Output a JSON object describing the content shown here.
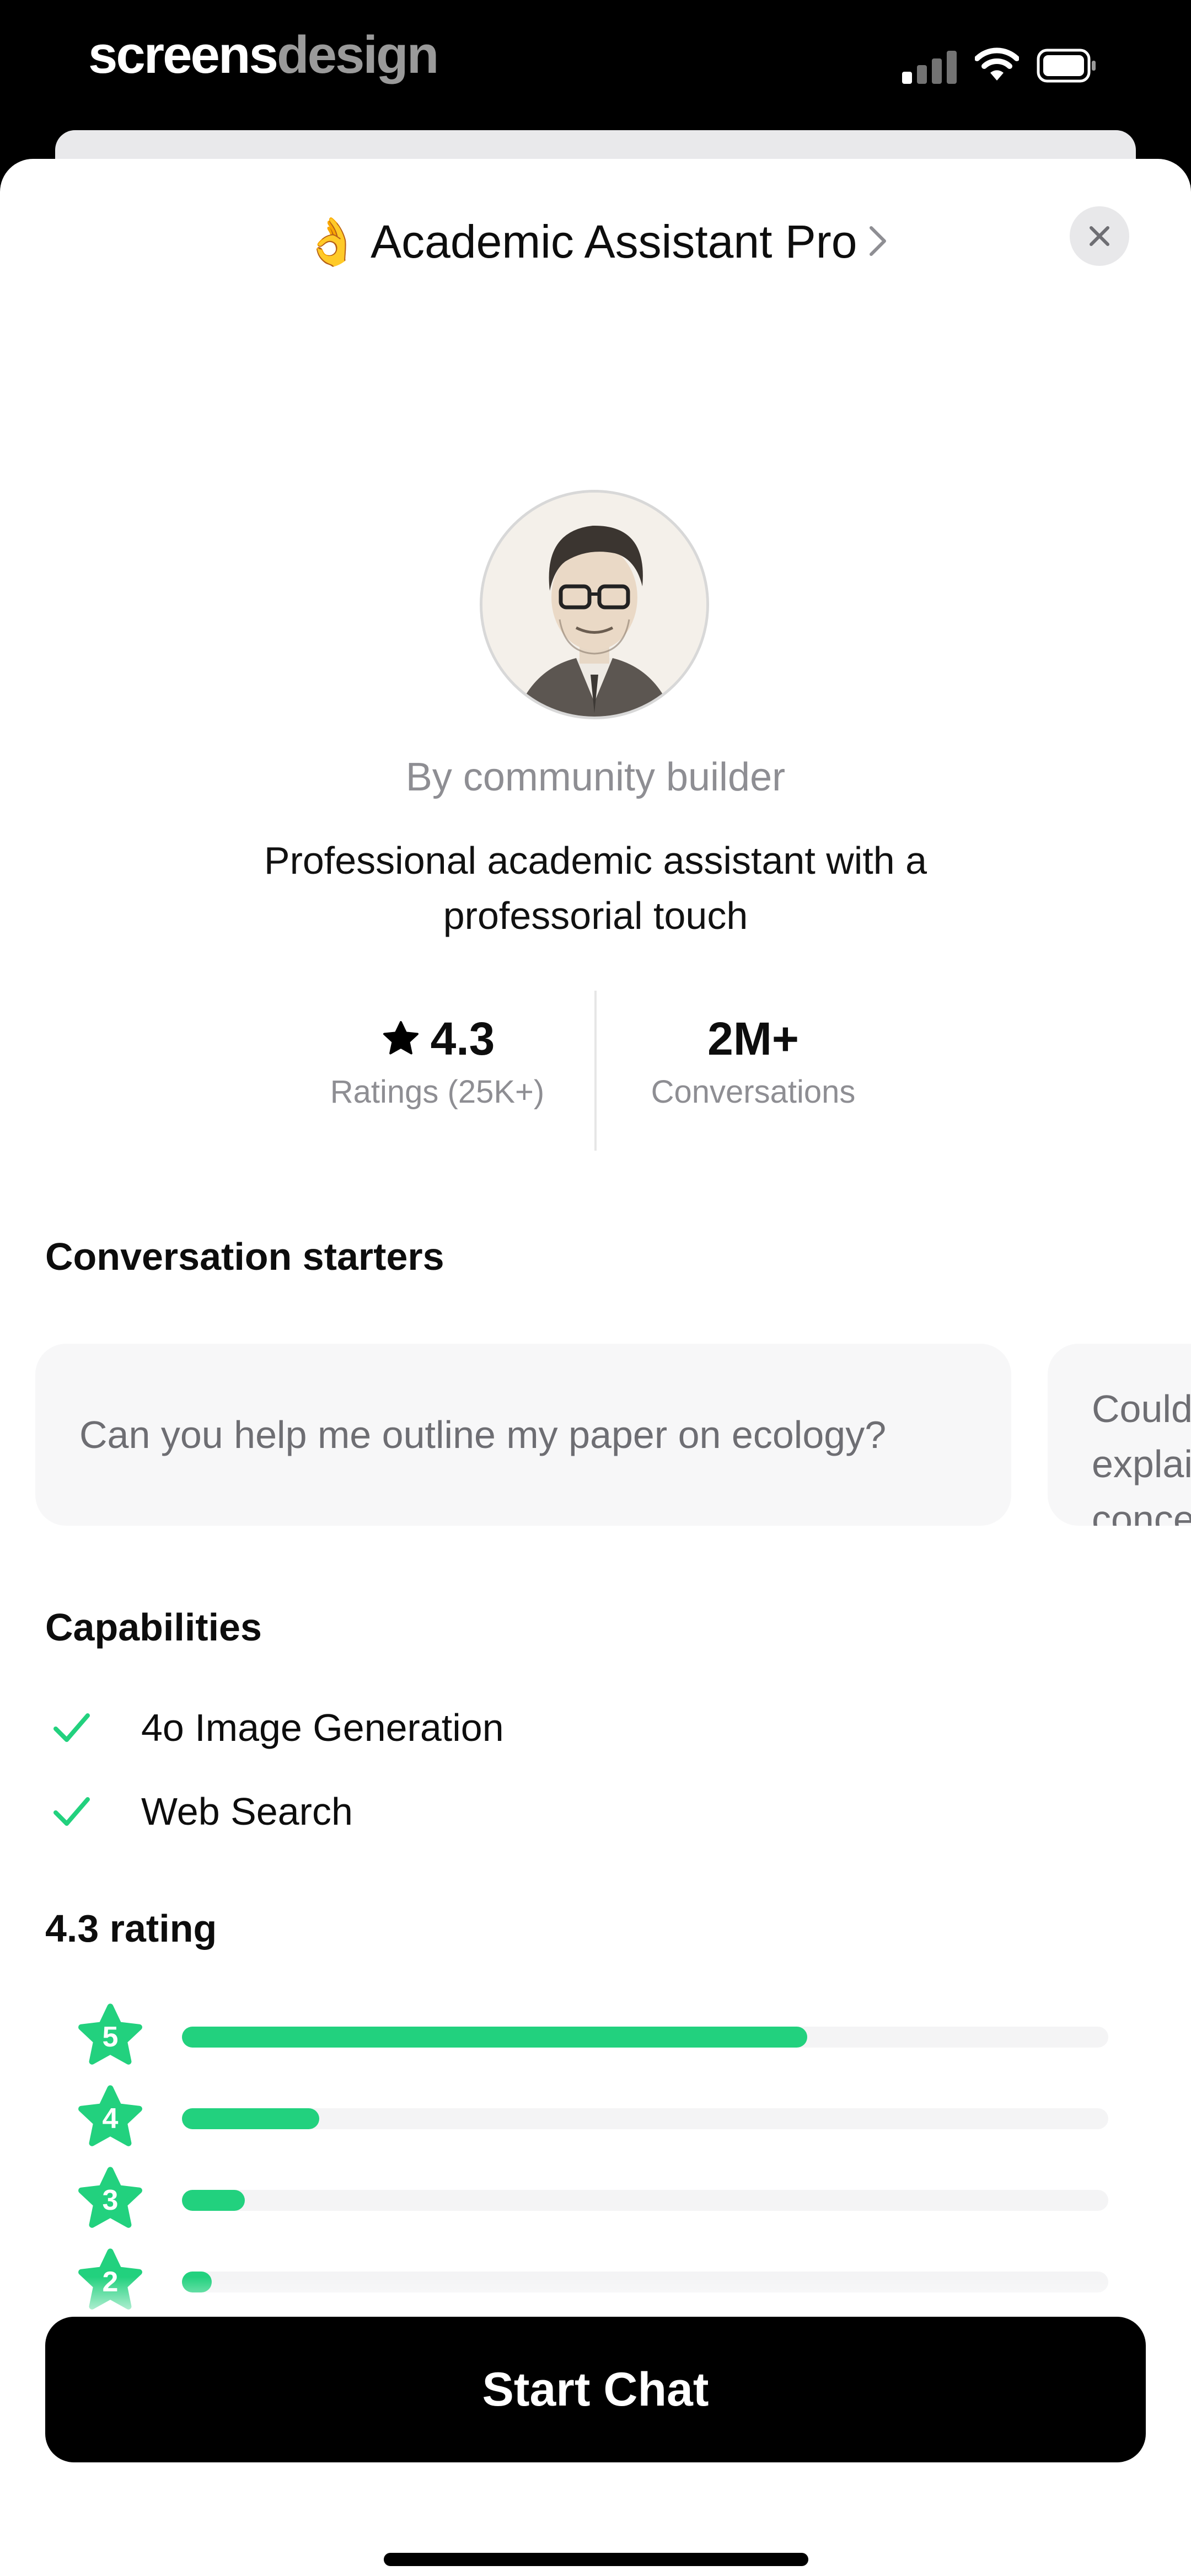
{
  "status_bar": {
    "brand_primary": "screens",
    "brand_secondary": "design",
    "icons": [
      "signal-icon",
      "wifi-icon",
      "battery-icon"
    ]
  },
  "header": {
    "emoji": "👌",
    "title": "Academic Assistant Pro",
    "chevron": "›",
    "close_icon": "close-icon"
  },
  "profile": {
    "byline": "By community builder",
    "description": "Professional academic assistant with a professorial touch"
  },
  "stats": {
    "rating_value": "4.3",
    "rating_label": "Ratings (25K+)",
    "conversations_value": "2M+",
    "conversations_label": "Conversations"
  },
  "starters": {
    "title": "Conversation starters",
    "items": [
      "Can you help me outline my paper on ecology?",
      "Could you explain this concept in more"
    ]
  },
  "capabilities": {
    "title": "Capabilities",
    "items": [
      "4o Image Generation",
      "Web Search"
    ]
  },
  "rating": {
    "title": "4.3 rating",
    "rows": [
      {
        "stars": "5",
        "fraction": 0.675
      },
      {
        "stars": "4",
        "fraction": 0.148
      },
      {
        "stars": "3",
        "fraction": 0.068
      },
      {
        "stars": "2",
        "fraction": 0.032
      }
    ]
  },
  "cta": {
    "label": "Start Chat"
  },
  "colors": {
    "accent_green": "#22d17e",
    "cta_background": "#000000",
    "muted_text": "#8e8e93"
  }
}
